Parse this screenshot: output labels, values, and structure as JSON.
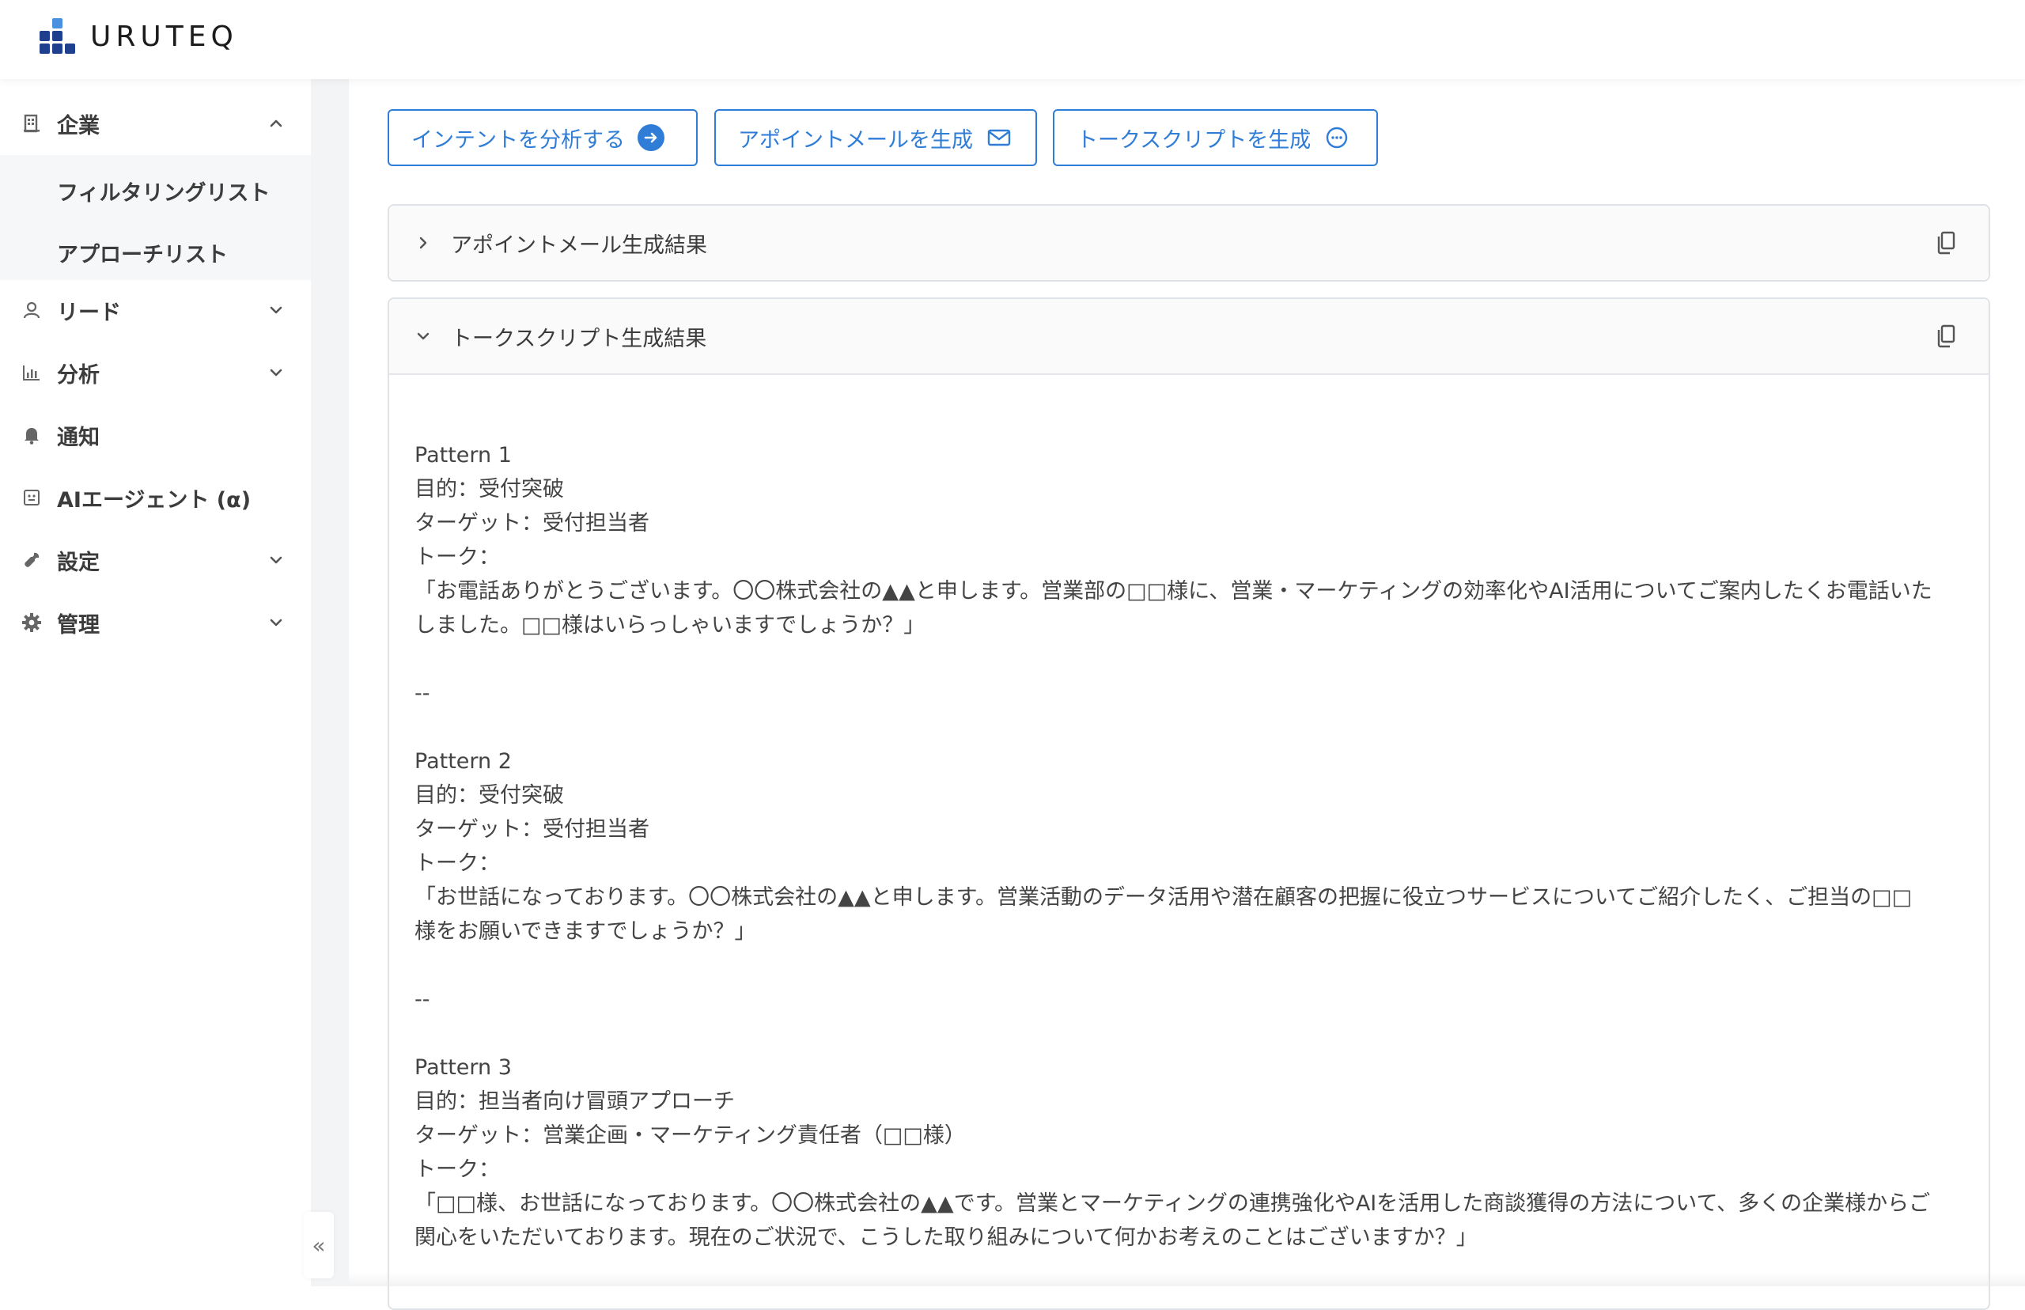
{
  "brand": {
    "name": "URUTEQ"
  },
  "sidebar": {
    "items": [
      {
        "label": "企業",
        "icon": "building-icon",
        "chevron": "up"
      },
      {
        "label": "リード",
        "icon": "user-icon",
        "chevron": "down"
      },
      {
        "label": "分析",
        "icon": "bar-chart-icon",
        "chevron": "down"
      },
      {
        "label": "通知",
        "icon": "bell-icon"
      },
      {
        "label": "AIエージェント (α)",
        "icon": "robot-icon"
      },
      {
        "label": "設定",
        "icon": "wrench-icon",
        "chevron": "down"
      },
      {
        "label": "管理",
        "icon": "gear-icon",
        "chevron": "down"
      }
    ],
    "submenu": [
      "フィルタリングリスト",
      "アプローチリスト"
    ],
    "collapse_label": "«"
  },
  "actions": {
    "analyze": "インテントを分析する",
    "gen_mail": "アポイントメールを生成",
    "gen_script": "トークスクリプトを生成"
  },
  "panels": {
    "mail": {
      "title": "アポイントメール生成結果",
      "expanded": false
    },
    "script": {
      "title": "トークスクリプト生成結果",
      "expanded": true
    }
  },
  "script": {
    "patterns": [
      {
        "name": "Pattern 1",
        "purpose": "目的：受付突破",
        "target": "ターゲット：受付担当者",
        "talk_label": "トーク：",
        "line1": "「お電話ありがとうございます。〇〇株式会社の▲▲と申します。営業部の□□様に、営業・マーケティングの効率化やAI活用についてご案内したくお電話いた",
        "line2": "しました。□□様はいらっしゃいますでしょうか？」"
      },
      {
        "name": "Pattern 2",
        "purpose": "目的：受付突破",
        "target": "ターゲット：受付担当者",
        "talk_label": "トーク：",
        "line1": "「お世話になっております。〇〇株式会社の▲▲と申します。営業活動のデータ活用や潜在顧客の把握に役立つサービスについてご紹介したく、ご担当の□□",
        "line2": "様をお願いできますでしょうか？」"
      },
      {
        "name": "Pattern 3",
        "purpose": "目的：担当者向け冒頭アプローチ",
        "target": "ターゲット：営業企画・マーケティング責任者（□□様）",
        "talk_label": "トーク：",
        "line1": "「□□様、お世話になっております。〇〇株式会社の▲▲です。営業とマーケティングの連携強化やAIを活用した商談獲得の方法について、多くの企業様からご",
        "line2": "関心をいただいております。現在のご状況で、こうした取り組みについて何かお考えのことはございますか？」"
      }
    ],
    "separator": "--"
  }
}
